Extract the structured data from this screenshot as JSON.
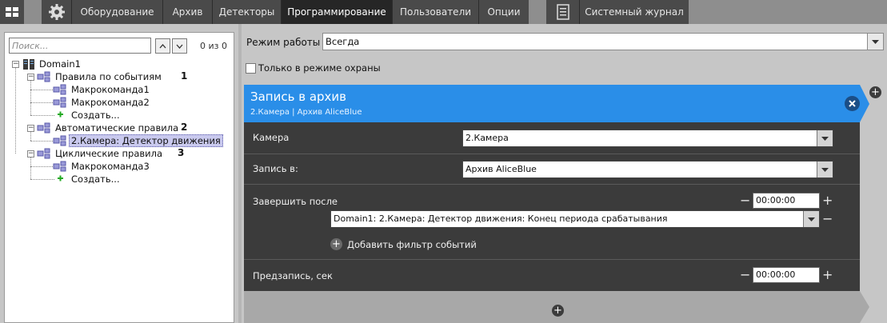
{
  "topbar": {
    "tabs": [
      {
        "label": "Оборудование"
      },
      {
        "label": "Архив"
      },
      {
        "label": "Детекторы"
      },
      {
        "label": "Программирование"
      },
      {
        "label": "Пользователи"
      },
      {
        "label": "Опции"
      }
    ],
    "journal_label": "Системный журнал"
  },
  "tree": {
    "search_placeholder": "Поиск...",
    "count": "0 из 0",
    "root": "Domain1",
    "groups": [
      {
        "label": "Правила по событиям",
        "number": "1",
        "children": [
          "Макрокоманда1",
          "Макрокоманда2",
          "Создать..."
        ]
      },
      {
        "label": "Автоматические правила",
        "number": "2",
        "children": [
          "2.Камера: Детектор движения"
        ]
      },
      {
        "label": "Циклические правила",
        "number": "3",
        "children": [
          "Макрокоманда3",
          "Создать..."
        ]
      }
    ]
  },
  "mode": {
    "label": "Режим работы",
    "value": "Всегда",
    "guard_only_label": "Только в режиме охраны"
  },
  "card": {
    "title": "Запись в архив",
    "subtitle": "2.Камера | Архив AliceBlue",
    "camera_label": "Камера",
    "camera_value": "2.Камера",
    "record_to_label": "Запись в:",
    "record_to_value": "Архив AliceBlue",
    "finish_after_label": "Завершить после",
    "finish_time": "00:00:00",
    "event_filter_value": "Domain1: 2.Камера: Детектор движения: Конец периода срабатывания",
    "add_filter_label": "Добавить фильтр событий",
    "prerecord_label": "Предзапись, сек",
    "prerecord_time": "00:00:00"
  },
  "colors": {
    "accent": "#2a8ee8",
    "card_body": "#3b3b3b",
    "active_tab": "#262626"
  }
}
